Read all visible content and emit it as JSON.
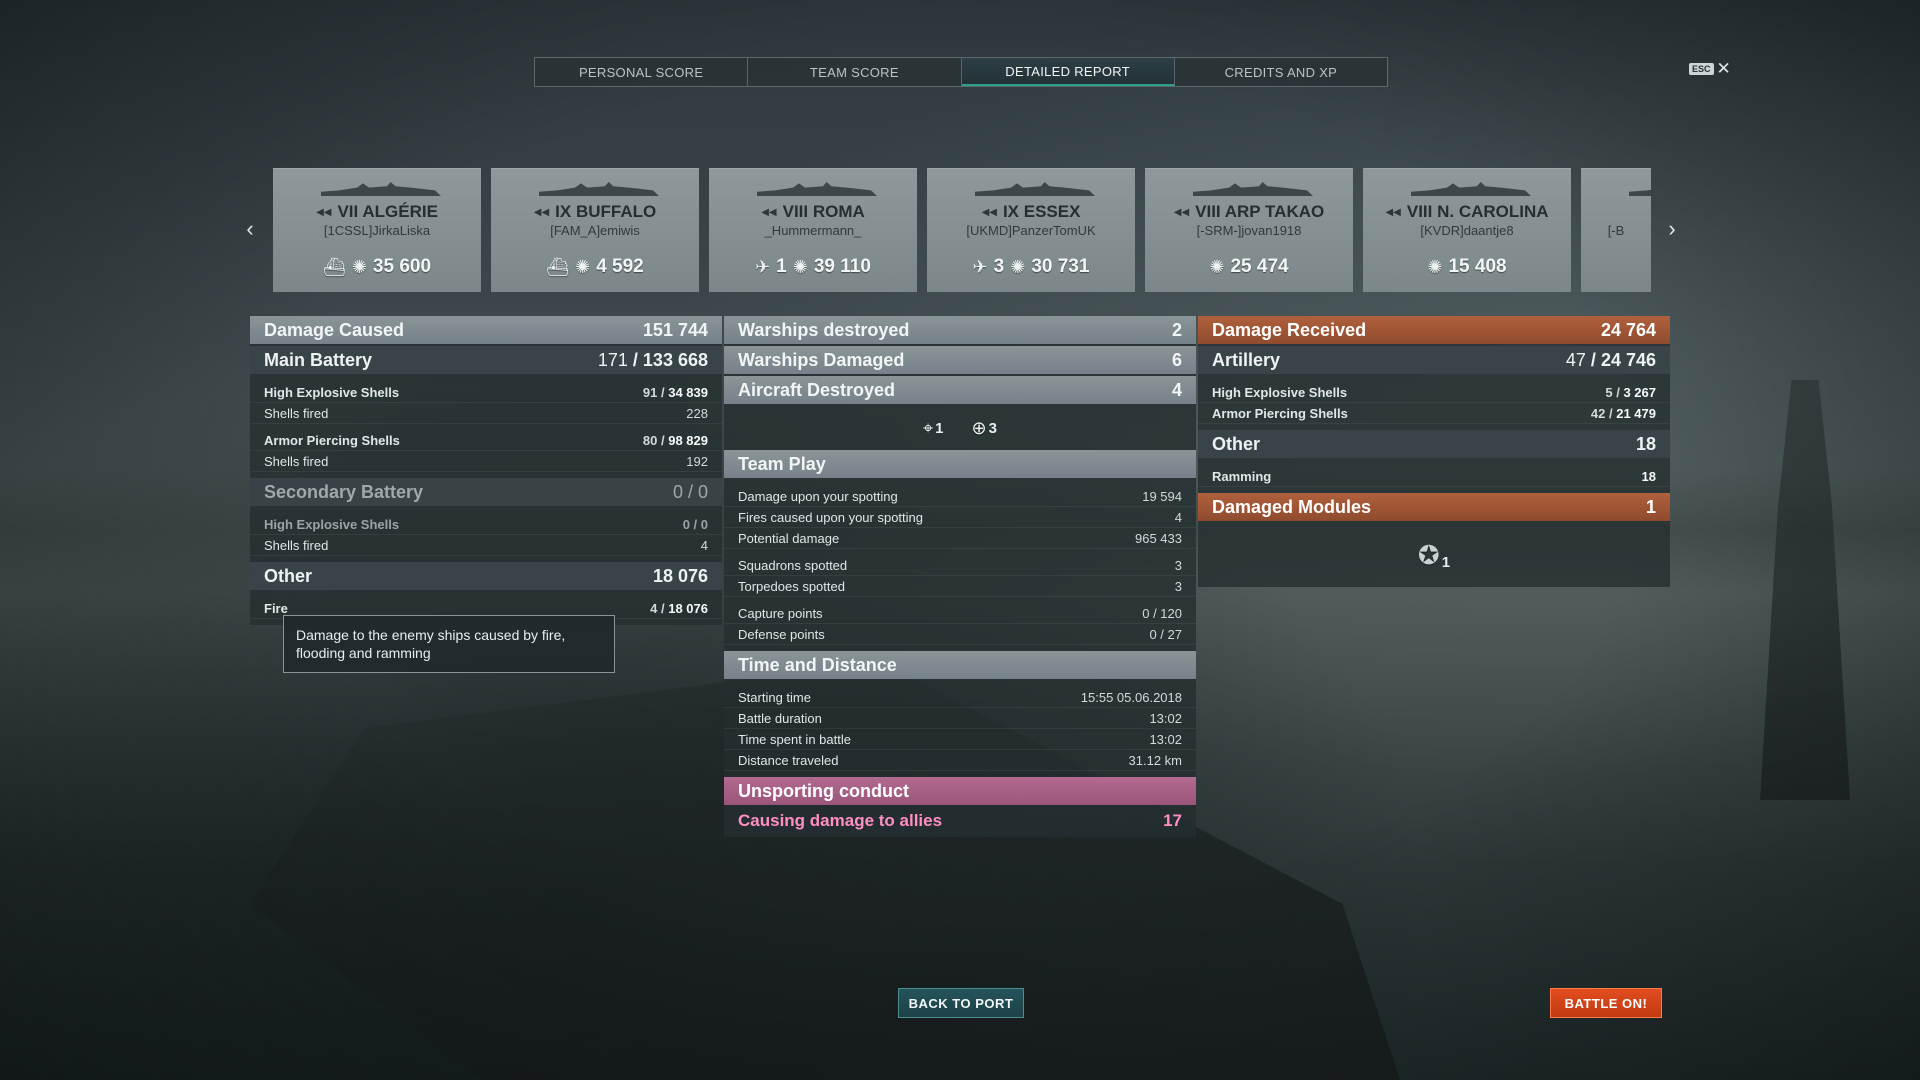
{
  "tabs": [
    "PERSONAL SCORE",
    "TEAM SCORE",
    "DETAILED REPORT",
    "CREDITS AND XP"
  ],
  "esc": {
    "key": "ESC",
    "close": "✕"
  },
  "ships": [
    {
      "name": "VII ALGÉRIE",
      "player": "[1CSSL]JirkaLiska",
      "stat1": "",
      "stat2": "35 600",
      "icon1": "ship-sunk-icon"
    },
    {
      "name": "IX BUFFALO",
      "player": "[FAM_A]emiwis",
      "stat1": "",
      "stat2": "4 592",
      "icon1": "ship-sunk-icon"
    },
    {
      "name": "VIII ROMA",
      "player": "_Hummermann_",
      "stat1": "1",
      "stat2": "39 110",
      "icon1": "aircraft-shot-icon"
    },
    {
      "name": "IX ESSEX",
      "player": "[UKMD]PanzerTomUK",
      "stat1": "3",
      "stat2": "30 731",
      "icon1": "aircraft-shot-icon"
    },
    {
      "name": "VIII ARP TAKAO",
      "player": "[-SRM-]jovan1918",
      "stat1": "",
      "stat2": "25 474",
      "icon1": ""
    },
    {
      "name": "VIII N. CAROLINA",
      "player": "[KVDR]daantje8",
      "stat1": "",
      "stat2": "15 408",
      "icon1": ""
    },
    {
      "name": "",
      "player": "[-B",
      "stat1": "",
      "stat2": "",
      "icon1": ""
    }
  ],
  "left": {
    "damage_caused": {
      "label": "Damage Caused",
      "value": "151 744"
    },
    "main_battery": {
      "label": "Main Battery",
      "hits": "171",
      "value": "133 668"
    },
    "he_shells": {
      "label": "High Explosive Shells",
      "hits": "91",
      "value": "34 839"
    },
    "he_fired": {
      "label": "Shells fired",
      "value": "228"
    },
    "ap_shells": {
      "label": "Armor Piercing Shells",
      "hits": "80",
      "value": "98 829"
    },
    "ap_fired": {
      "label": "Shells fired",
      "value": "192"
    },
    "secondary": {
      "label": "Secondary Battery",
      "value": "0 / 0"
    },
    "sec_he": {
      "label": "High Explosive Shells",
      "value": "0 / 0"
    },
    "sec_fired": {
      "label": "Shells fired",
      "value": "4"
    },
    "other": {
      "label": "Other",
      "value": "18 076"
    },
    "fire": {
      "label": "Fire",
      "hits": "4",
      "value": "18 076"
    }
  },
  "tooltip": "Damage to the enemy ships caused by fire, flooding and ramming",
  "middle": {
    "warships_destroyed": {
      "label": "Warships destroyed",
      "value": "2"
    },
    "warships_damaged": {
      "label": "Warships Damaged",
      "value": "6"
    },
    "aircraft_destroyed": {
      "label": "Aircraft Destroyed",
      "value": "4",
      "a1": "1",
      "a2": "3"
    },
    "team_play": {
      "label": "Team Play"
    },
    "rows1": [
      {
        "label": "Damage upon your spotting",
        "value": "19 594"
      },
      {
        "label": "Fires caused upon your spotting",
        "value": "4"
      },
      {
        "label": "Potential damage",
        "value": "965 433"
      }
    ],
    "rows2": [
      {
        "label": "Squadrons spotted",
        "value": "3"
      },
      {
        "label": "Torpedoes spotted",
        "value": "3"
      }
    ],
    "rows3": [
      {
        "label": "Capture points",
        "value": "0 / 120"
      },
      {
        "label": "Defense points",
        "value": "0 / 27"
      }
    ],
    "time_distance": {
      "label": "Time and Distance"
    },
    "time_rows": [
      {
        "label": "Starting time",
        "value": "15:55  05.06.2018"
      },
      {
        "label": "Battle duration",
        "value": "13:02"
      },
      {
        "label": "Time spent in battle",
        "value": "13:02"
      },
      {
        "label": "Distance traveled",
        "value": "31.12 km"
      }
    ],
    "unsporting": {
      "label": "Unsporting conduct",
      "row_label": "Causing damage to allies",
      "row_value": "17"
    }
  },
  "right": {
    "damage_received": {
      "label": "Damage Received",
      "value": "24 764"
    },
    "artillery": {
      "label": "Artillery",
      "hits": "47",
      "value": "24 746"
    },
    "he": {
      "label": "High Explosive Shells",
      "hits": "5",
      "value": "3 267"
    },
    "ap": {
      "label": "Armor Piercing Shells",
      "hits": "42",
      "value": "21 479"
    },
    "other": {
      "label": "Other",
      "value": "18"
    },
    "ramming": {
      "label": "Ramming",
      "value": "18"
    },
    "modules": {
      "label": "Damaged Modules",
      "value": "1",
      "icon_count": "1"
    }
  },
  "buttons": {
    "back": "BACK TO PORT",
    "battle": "BATTLE ON!"
  },
  "colors": {
    "accent_teal": "#2f9e8d",
    "damage_received": "#a6573a",
    "unsporting": "#a85e85",
    "battle_button": "#d8421a"
  }
}
